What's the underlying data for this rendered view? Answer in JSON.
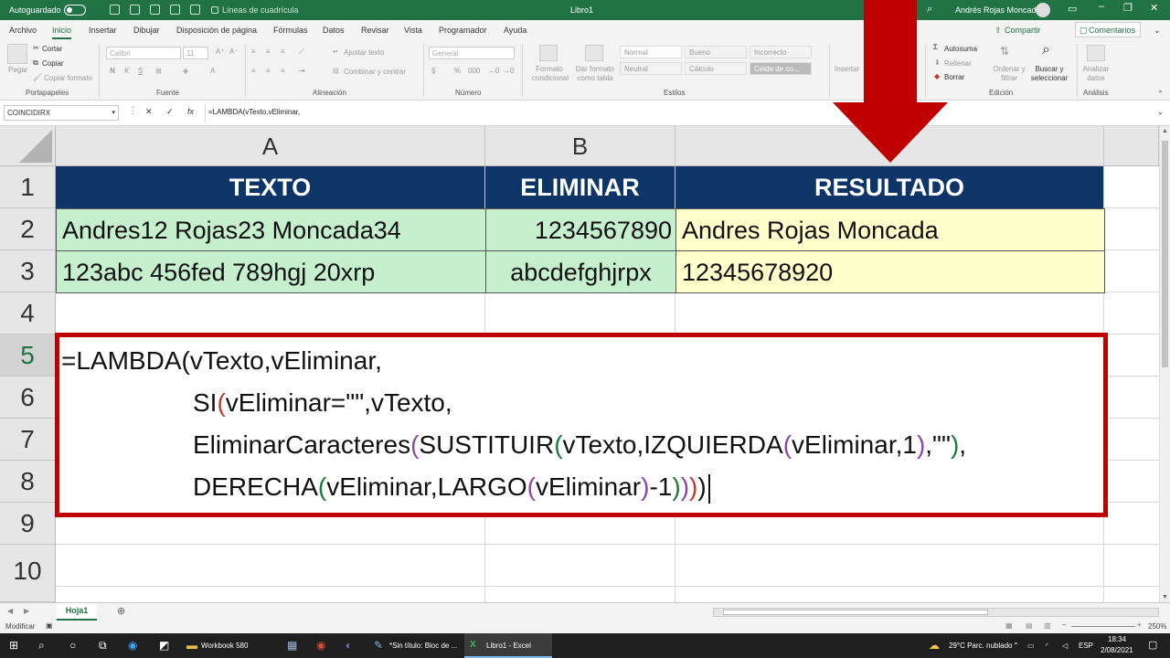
{
  "titlebar": {
    "autosave": "Autoguardado",
    "gridlines": "Líneas de cuadrícula",
    "filename": "Libro1",
    "user": "Andrés Rojas Moncada"
  },
  "menu": {
    "tabs": [
      "Archivo",
      "Inicio",
      "Insertar",
      "Dibujar",
      "Disposición de página",
      "Fórmulas",
      "Datos",
      "Revisar",
      "Vista",
      "Programador",
      "Ayuda"
    ],
    "share": "Compartir",
    "comments": "Comentarios"
  },
  "ribbon": {
    "clipboard": {
      "paste": "Pegar",
      "cut": "Cortar",
      "copy": "Copiar",
      "format_painter": "Copiar formato",
      "label": "Portapapeles"
    },
    "font": {
      "name": "Calibri",
      "size": "11",
      "bold": "N",
      "italic": "K",
      "underline": "S",
      "label": "Fuente"
    },
    "alignment": {
      "wrap": "Ajustar texto",
      "merge": "Combinar y centrar",
      "label": "Alineación"
    },
    "number": {
      "format": "General",
      "label": "Número"
    },
    "styles": {
      "conditional": "Formato condicional",
      "table": "Dar formato como tabla",
      "normal": "Normal",
      "bueno": "Bueno",
      "incorrecto": "Incorrecto",
      "neutral": "Neutral",
      "calculo": "Cálculo",
      "celda": "Celda de co...",
      "label": "Estilos"
    },
    "cells": {
      "insert": "Insertar"
    },
    "editing": {
      "autosum": "Autosuma",
      "fill": "Rellenar",
      "clear": "Borrar",
      "sort": "Ordenar y filtrar",
      "find": "Buscar y seleccionar",
      "label": "Edición"
    },
    "analysis": {
      "analyze": "Analizar datos",
      "label": "Análisis"
    }
  },
  "formula_bar": {
    "name_box": "COINCIDIRX",
    "cancel": "✕",
    "enter": "✓",
    "fx": "fx",
    "content": "=LAMBDA(vTexto,vEliminar,"
  },
  "columns": [
    "A",
    "B"
  ],
  "rows": [
    "1",
    "2",
    "3",
    "4",
    "5",
    "6",
    "7",
    "8",
    "9",
    "10"
  ],
  "table": {
    "headers": [
      "TEXTO",
      "ELIMINAR",
      "RESULTADO"
    ],
    "rows": [
      [
        "Andres12 Rojas23 Moncada34",
        "1234567890",
        "Andres Rojas Moncada"
      ],
      [
        "123abc 456fed 789hgj 20xrp",
        "abcdefghjrpx",
        "12345678920"
      ]
    ]
  },
  "formula_lines": {
    "l1": "=LAMBDA(vTexto,vEliminar,",
    "l2a": "SI",
    "l2b": "(",
    "l2c": "vEliminar=\"\",vTexto,",
    "l3a": "EliminarCaracteres",
    "l3b": "(",
    "l3c": "SUSTITUIR",
    "l3d": "(",
    "l3e": "vTexto,IZQUIERDA",
    "l3f": "(",
    "l3g": "vEliminar,1",
    "l3h": ")",
    "l3i": ",\"\"",
    "l3j": ")",
    "l3k": ",",
    "l4a": "DERECHA",
    "l4b": "(",
    "l4c": "vEliminar,LARGO",
    "l4d": "(",
    "l4e": "vEliminar",
    "l4f": ")",
    "l4g": "-1",
    "l4h": ")",
    "l4i": ")",
    "l4j": ")",
    "l4k": ")"
  },
  "sheet": {
    "tab": "Hoja1"
  },
  "status": {
    "mode": "Modificar",
    "zoom": "250%"
  },
  "taskbar": {
    "items": [
      "Workbook 580",
      "*Sin título: Bloc de ...",
      "Libro1 - Excel"
    ],
    "weather": "29°C Parc. nublado",
    "lang": "ESP",
    "time": "18:34",
    "date": "2/08/2021"
  },
  "colors": {
    "excel_green": "#217346",
    "header_blue": "#0d3568",
    "green_fill": "#c6efce",
    "yellow_fill": "#ffffcc",
    "highlight_red": "#c00000"
  }
}
